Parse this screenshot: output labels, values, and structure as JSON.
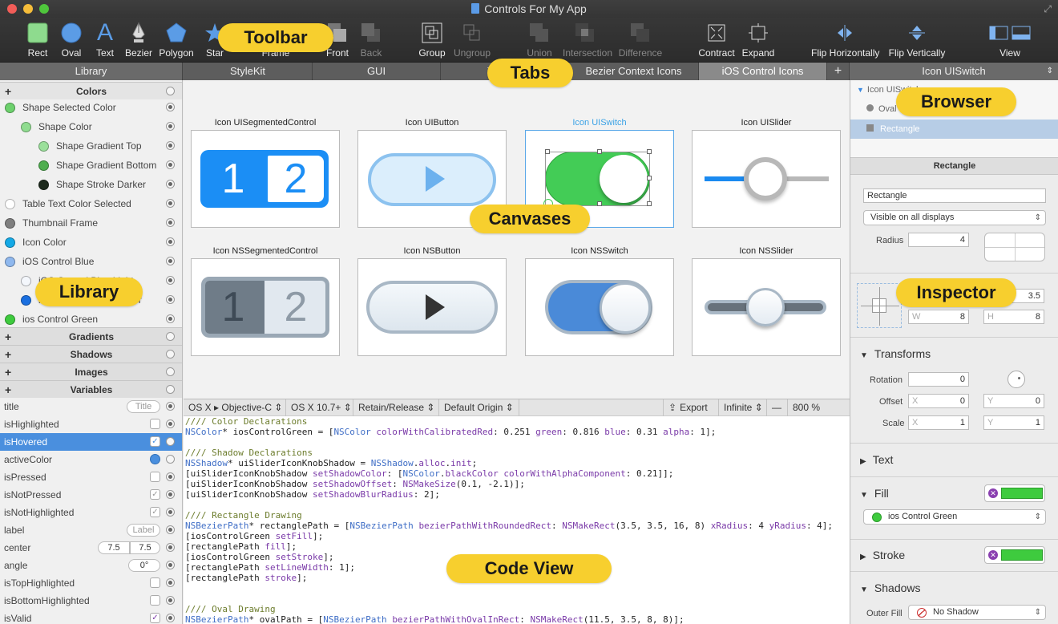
{
  "window": {
    "title": "Controls For My App"
  },
  "toolbar": {
    "items": [
      {
        "label": "Rect",
        "icon": "rect-icon"
      },
      {
        "label": "Oval",
        "icon": "oval-icon"
      },
      {
        "label": "Text",
        "icon": "text-icon"
      },
      {
        "label": "Bezier",
        "icon": "bezier-icon"
      },
      {
        "label": "Polygon",
        "icon": "polygon-icon"
      },
      {
        "label": "Star",
        "icon": "star-icon"
      },
      {
        "label": "Frame",
        "icon": "frame-icon"
      },
      {
        "label": "Front",
        "icon": "front-icon"
      },
      {
        "label": "Back",
        "icon": "back-icon"
      },
      {
        "label": "Group",
        "icon": "group-icon"
      },
      {
        "label": "Ungroup",
        "icon": "ungroup-icon"
      },
      {
        "label": "Union",
        "icon": "union-icon"
      },
      {
        "label": "Intersection",
        "icon": "intersection-icon"
      },
      {
        "label": "Difference",
        "icon": "difference-icon"
      },
      {
        "label": "Contract",
        "icon": "contract-icon"
      },
      {
        "label": "Expand",
        "icon": "expand-icon"
      },
      {
        "label": "Flip Horizontally",
        "icon": "flip-horizontal-icon"
      },
      {
        "label": "Flip Vertically",
        "icon": "flip-vertical-icon"
      },
      {
        "label": "View",
        "icon": "view-icon"
      }
    ]
  },
  "tabs": [
    "StyleKit",
    "GUI",
    "Toolbar",
    "Bezier Context Icons",
    "iOS Control Icons"
  ],
  "add_tab": "+",
  "library": {
    "header": "Library",
    "colors_title": "Colors",
    "colors": [
      {
        "name": "Shape Selected Color",
        "color": "#6dd16d"
      },
      {
        "name": "Shape Color",
        "color": "#8fdc8f"
      },
      {
        "name": "Shape Gradient Top",
        "color": "#9be09b"
      },
      {
        "name": "Shape Gradient Bottom",
        "color": "#4fae4f"
      },
      {
        "name": "Shape Stroke Darker",
        "color": "#1d2a1d"
      },
      {
        "name": "Table Text Color Selected",
        "color": "#ffffff"
      },
      {
        "name": "Thumbnail Frame",
        "color": "#7f7f7f"
      },
      {
        "name": "Icon Color",
        "color": "#14a9e6"
      },
      {
        "name": "iOS Control Blue",
        "color": "#8fb8ee"
      },
      {
        "name": "iOS Control Blue Light",
        "color": "#f4f7fc"
      },
      {
        "name": "iOS Control Blue Darker",
        "color": "#1a6fe0"
      },
      {
        "name": "ios Control Green",
        "color": "#3ecb3e"
      }
    ],
    "sections": [
      "Gradients",
      "Shadows",
      "Images",
      "Variables"
    ],
    "variables": [
      {
        "name": "title",
        "value": "Title"
      },
      {
        "name": "isHighlighted",
        "value": ""
      },
      {
        "name": "isHovered",
        "value": "✓"
      },
      {
        "name": "activeColor",
        "value": ""
      },
      {
        "name": "isPressed",
        "value": ""
      },
      {
        "name": "isNotPressed",
        "value": "✓"
      },
      {
        "name": "isNotHighlighted",
        "value": "✓"
      },
      {
        "name": "label",
        "value": "Label"
      },
      {
        "name": "center",
        "value": "7.5",
        "value2": "7.5"
      },
      {
        "name": "angle",
        "value": "0°"
      },
      {
        "name": "isTopHighlighted",
        "value": ""
      },
      {
        "name": "isBottomHighlighted",
        "value": ""
      },
      {
        "name": "isValid",
        "value": "✓"
      }
    ]
  },
  "canvases": [
    {
      "title": "Icon UISegmentedControl",
      "seg": [
        "1",
        "2"
      ]
    },
    {
      "title": "Icon UIButton"
    },
    {
      "title": "Icon UISwitch"
    },
    {
      "title": "Icon UISlider"
    },
    {
      "title": "Icon NSSegmentedControl",
      "seg": [
        "1",
        "2"
      ]
    },
    {
      "title": "Icon NSButton"
    },
    {
      "title": "Icon NSSwitch"
    },
    {
      "title": "Icon NSSlider"
    }
  ],
  "codebar": {
    "platform": "OS X ▸ Objective-C ⇕",
    "version": "OS X 10.7+ ⇕",
    "memory": "Retain/Release ⇕",
    "origin": "Default Origin ⇕",
    "export": "Export",
    "infinite": "Infinite ⇕",
    "zoom_minus": "—",
    "zoom": "800 %"
  },
  "code_lines": [
    {
      "t": "//// Color Declarations",
      "c": "cm"
    },
    {
      "t": "NSColor* iosControlGreen = [NSColor colorWithCalibratedRed: 0.251 green: 0.816 blue: 0.31 alpha: 1];",
      "c": "pl"
    },
    {
      "t": "",
      "c": "pl"
    },
    {
      "t": "//// Shadow Declarations",
      "c": "cm"
    },
    {
      "t": "NSShadow* uiSliderIconKnobShadow = NSShadow.alloc.init;",
      "c": "pl"
    },
    {
      "t": "[uiSliderIconKnobShadow setShadowColor: [NSColor.blackColor colorWithAlphaComponent: 0.21]];",
      "c": "pl"
    },
    {
      "t": "[uiSliderIconKnobShadow setShadowOffset: NSMakeSize(0.1, -2.1)];",
      "c": "pl"
    },
    {
      "t": "[uiSliderIconKnobShadow setShadowBlurRadius: 2];",
      "c": "pl"
    },
    {
      "t": "",
      "c": "pl"
    },
    {
      "t": "//// Rectangle Drawing",
      "c": "cm"
    },
    {
      "t": "NSBezierPath* rectanglePath = [NSBezierPath bezierPathWithRoundedRect: NSMakeRect(3.5, 3.5, 16, 8) xRadius: 4 yRadius: 4];",
      "c": "pl"
    },
    {
      "t": "[iosControlGreen setFill];",
      "c": "pl"
    },
    {
      "t": "[rectanglePath fill];",
      "c": "pl"
    },
    {
      "t": "[iosControlGreen setStroke];",
      "c": "pl"
    },
    {
      "t": "[rectanglePath setLineWidth: 1];",
      "c": "pl"
    },
    {
      "t": "[rectanglePath stroke];",
      "c": "pl"
    },
    {
      "t": "",
      "c": "pl"
    },
    {
      "t": "",
      "c": "pl"
    },
    {
      "t": "//// Oval Drawing",
      "c": "cm"
    },
    {
      "t": "NSBezierPath* ovalPath = [NSBezierPath bezierPathWithOvalInRect: NSMakeRect(11.5, 3.5, 8, 8)];",
      "c": "pl"
    }
  ],
  "browser": {
    "header": "Icon UISwitch",
    "items": [
      {
        "label": "Icon UISwitch"
      },
      {
        "label": "Oval"
      },
      {
        "label": "Rectangle"
      }
    ]
  },
  "inspector": {
    "title": "Rectangle",
    "name_field": "Rectangle",
    "visibility": "Visible on all displays",
    "radius_label": "Radius",
    "radius": "4",
    "y_value": "3.5",
    "w_ph": "W",
    "w": "8",
    "h_ph": "H",
    "h": "8",
    "transforms": "Transforms",
    "rotation_label": "Rotation",
    "rotation": "0",
    "offset_label": "Offset",
    "offset_x_ph": "X",
    "offset_x": "0",
    "offset_y_ph": "Y",
    "offset_y": "0",
    "scale_label": "Scale",
    "scale_x_ph": "X",
    "scale_x": "1",
    "scale_y_ph": "Y",
    "scale_y": "1",
    "text": "Text",
    "fill": "Fill",
    "fill_color_name": "ios Control Green",
    "stroke": "Stroke",
    "shadows": "Shadows",
    "outer_fill_label": "Outer Fill",
    "outer_fill": "No Shadow",
    "accent": "#3ecb3e"
  },
  "callouts": [
    "Toolbar",
    "Tabs",
    "Browser",
    "Library",
    "Canvases",
    "Inspector",
    "Code View"
  ]
}
